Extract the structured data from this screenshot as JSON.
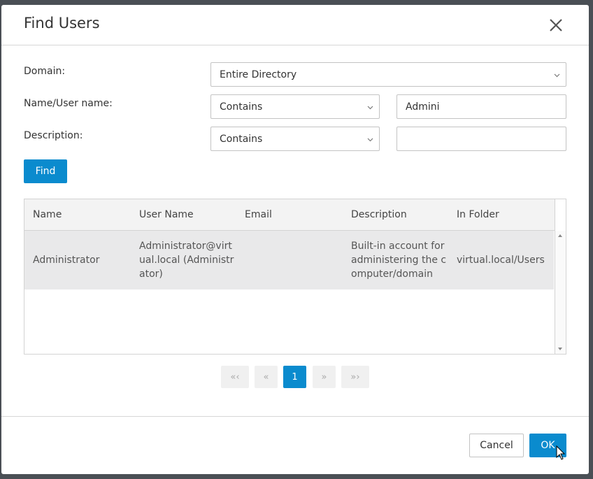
{
  "dialog": {
    "title": "Find Users",
    "close_icon": "close-icon"
  },
  "form": {
    "domain_label": "Domain:",
    "domain_value": "Entire Directory",
    "name_label": "Name/User name:",
    "name_operator": "Contains",
    "name_value": "Admini",
    "description_label": "Description:",
    "description_operator": "Contains",
    "description_value": "",
    "find_label": "Find"
  },
  "grid": {
    "columns": [
      "Name",
      "User Name",
      "Email",
      "Description",
      "In Folder"
    ],
    "rows": [
      {
        "name": "Administrator",
        "user_name": "Administrator@virt\nual.local (Administr\nator)",
        "email": "",
        "description": "Built-in account for\nadministering the c\nomputer/domain",
        "in_folder": "virtual.local/Users"
      }
    ]
  },
  "pager": {
    "first": "«‹",
    "prev": "«",
    "current": "1",
    "next": "»",
    "last": "»›"
  },
  "footer": {
    "cancel_label": "Cancel",
    "ok_label": "OK"
  },
  "colors": {
    "accent": "#0a8bce",
    "selected_row": "#e9e9ea",
    "backdrop": "#4a4f55"
  }
}
